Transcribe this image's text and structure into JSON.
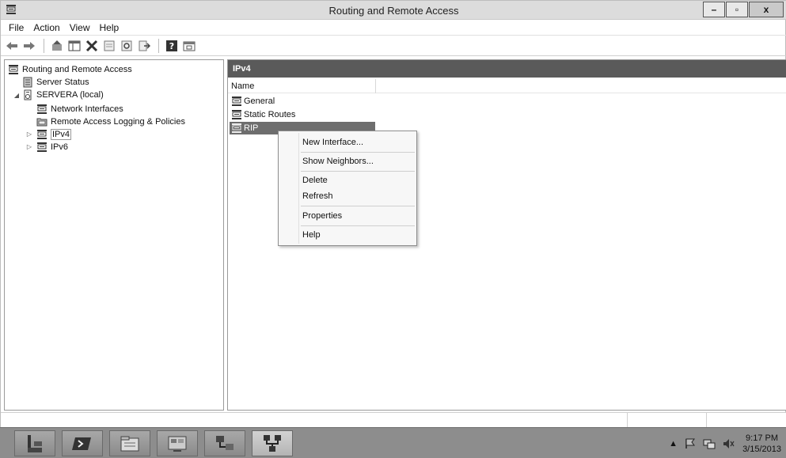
{
  "window": {
    "title": "Routing and Remote Access",
    "controls": {
      "minimize": "–",
      "restore": "▫",
      "close": "x"
    }
  },
  "menubar": {
    "items": [
      "File",
      "Action",
      "View",
      "Help"
    ]
  },
  "toolbar": {
    "icons": [
      "back-icon",
      "forward-icon",
      "up-icon",
      "show-hide-tree-icon",
      "delete-icon",
      "properties-icon",
      "refresh-icon",
      "export-icon",
      "help-icon",
      "console-icon"
    ]
  },
  "tree": {
    "root": "Routing and Remote Access",
    "server_status": "Server Status",
    "server": "SERVERA (local)",
    "network_interfaces": "Network Interfaces",
    "logging": "Remote Access Logging & Policies",
    "ipv4": "IPv4",
    "ipv6": "IPv6"
  },
  "list": {
    "header": "IPv4",
    "column_name": "Name",
    "rows": [
      "General",
      "Static Routes",
      "RIP"
    ],
    "selected_row": "RIP"
  },
  "context_menu": {
    "items": [
      "New Interface...",
      "Show Neighbors...",
      "Delete",
      "Refresh",
      "Properties",
      "Help"
    ]
  },
  "taskbar": {
    "apps": [
      "server-manager-icon",
      "powershell-icon",
      "file-explorer-icon",
      "control-panel-icon",
      "network-icon",
      "routing-remote-access-icon"
    ],
    "clock_time": "9:17 PM",
    "clock_date": "3/15/2013",
    "tray_arrow": "▲"
  },
  "colors": {
    "selection": "#6e6e6e",
    "pane_header": "#5a5a5a",
    "taskbar": "#8d8d8d"
  }
}
